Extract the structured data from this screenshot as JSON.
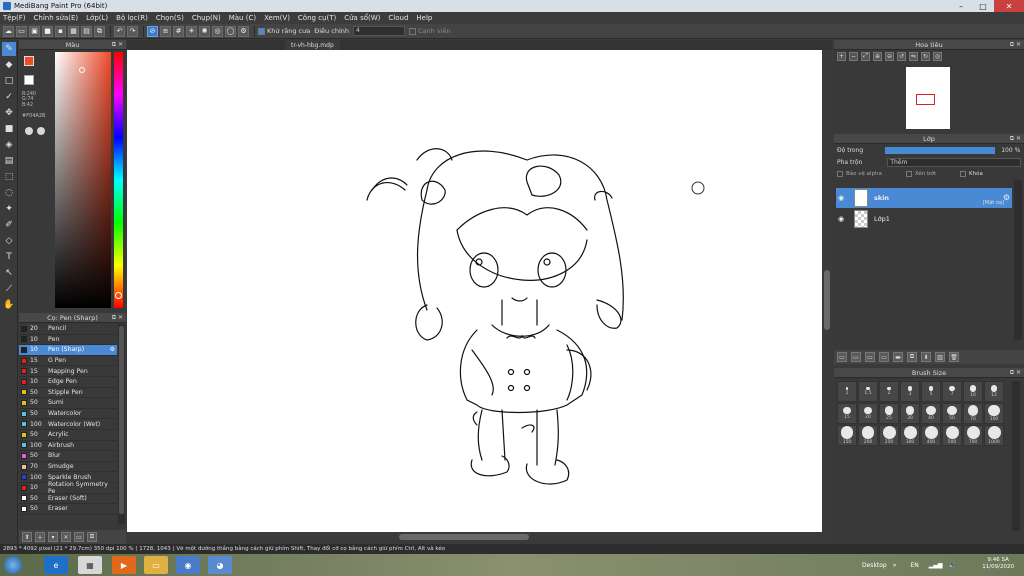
{
  "window": {
    "title": "MediBang Paint Pro (64bit)"
  },
  "menu": [
    "Tệp(F)",
    "Chỉnh sửa(E)",
    "Lớp(L)",
    "Bộ lọc(R)",
    "Chọn(S)",
    "Chụp(N)",
    "Màu (C)",
    "Xem(V)",
    "Công cụ(T)",
    "Cửa sổ(W)",
    "Cloud",
    "Help"
  ],
  "toolbar": {
    "antialias_label": "Khử răng cưa",
    "correction_label": "Điều chỉnh",
    "correction_value": "4",
    "edge_label": "Cạnh viền"
  },
  "color_panel": {
    "title": "Màu",
    "primary_color": "#f04a2a",
    "rgb": [
      "R:240",
      "G:74",
      "B:42"
    ],
    "hex": "#F04A2B"
  },
  "brush_panel": {
    "title": "Cọ: Pen (Sharp)",
    "brushes": [
      {
        "size": "20",
        "name": "Pencil",
        "color": "#222222",
        "selected": false
      },
      {
        "size": "10",
        "name": "Pen",
        "color": "#222222",
        "selected": false
      },
      {
        "size": "10",
        "name": "Pen (Sharp)",
        "color": "#222222",
        "selected": true
      },
      {
        "size": "15",
        "name": "G Pen",
        "color": "#e02020",
        "selected": false
      },
      {
        "size": "15",
        "name": "Mapping Pen",
        "color": "#e02020",
        "selected": false
      },
      {
        "size": "10",
        "name": "Edge Pen",
        "color": "#e02020",
        "selected": false
      },
      {
        "size": "50",
        "name": "Stipple Pen",
        "color": "#e0c020",
        "selected": false
      },
      {
        "size": "50",
        "name": "Sumi",
        "color": "#e0c020",
        "selected": false
      },
      {
        "size": "50",
        "name": "Watercolor",
        "color": "#60c0e0",
        "selected": false
      },
      {
        "size": "100",
        "name": "Watercolor (Wet)",
        "color": "#60c0e0",
        "selected": false
      },
      {
        "size": "50",
        "name": "Acrylic",
        "color": "#e0c020",
        "selected": false
      },
      {
        "size": "100",
        "name": "Airbrush",
        "color": "#60c0e0",
        "selected": false
      },
      {
        "size": "50",
        "name": "Blur",
        "color": "#e060e0",
        "selected": false
      },
      {
        "size": "70",
        "name": "Smudge",
        "color": "#e8c0a0",
        "selected": false
      },
      {
        "size": "100",
        "name": "Sparkle Brush",
        "color": "#2040e0",
        "selected": false
      },
      {
        "size": "10",
        "name": "Rotation Symmetry Pe",
        "color": "#e02020",
        "selected": false
      },
      {
        "size": "50",
        "name": "Eraser (Soft)",
        "color": "#ffffff",
        "selected": false
      },
      {
        "size": "50",
        "name": "Eraser",
        "color": "#ffffff",
        "selected": false
      }
    ]
  },
  "canvas": {
    "tab": "tr-vh-hbg.mdp"
  },
  "nav_panel": {
    "title": "Hoa tiêu"
  },
  "layer_panel": {
    "title": "Lớp",
    "opacity_label": "Độ trong",
    "opacity_value": "100 %",
    "opacity": 1.0,
    "blend_label": "Pha trộn",
    "blend_value": "Thêm",
    "opt_alpha": "Bảo vệ alpha",
    "opt_clip": "Xén bớt",
    "opt_lock": "Khóa",
    "layers": [
      {
        "name": "skin",
        "mode": "[Mặt nạ]",
        "selected": true
      },
      {
        "name": "Lớp1",
        "mode": "",
        "selected": false
      }
    ]
  },
  "brush_size_panel": {
    "title": "Brush Size",
    "sizes": [
      "1",
      "1.5",
      "2",
      "3",
      "5",
      "7",
      "10",
      "12",
      "15",
      "20",
      "25",
      "30",
      "40",
      "50",
      "70",
      "100",
      "150",
      "200",
      "250",
      "300",
      "400",
      "500",
      "700",
      "1000"
    ]
  },
  "status": {
    "text": "2893 * 4092 pixel   (21 * 29.7cm)   350 dpi   100 %   ( 1728, 1043 )   Vẽ một đường thẳng bằng cách giữ phím Shift, Thay đổi cỡ cọ bằng cách giữ phím Ctrl, Alt và kéo"
  },
  "taskbar": {
    "desktop_label": "Desktop",
    "lang": "EN",
    "time": "9:46 SA",
    "date": "11/09/2020"
  }
}
